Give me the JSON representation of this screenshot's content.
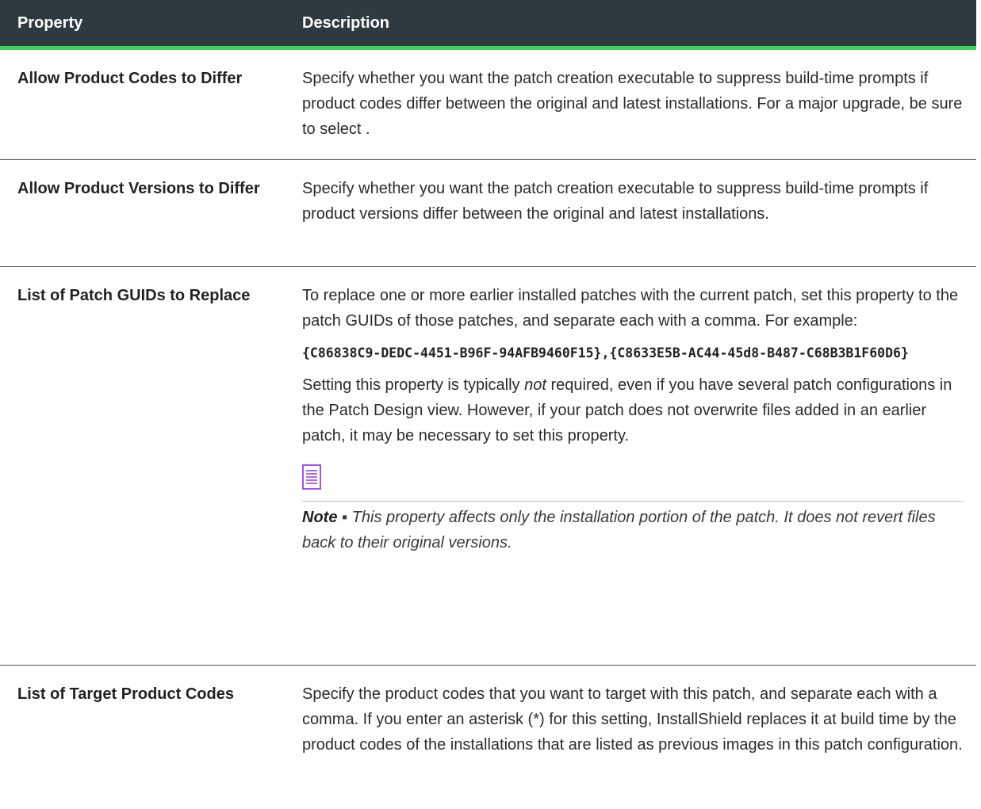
{
  "header": {
    "property": "Property",
    "description": "Description"
  },
  "rows": [
    {
      "property": "Allow Product Codes to Differ",
      "description": "Specify whether you want the patch creation executable to suppress build-time prompts if product codes differ between the original and latest installations. For a major upgrade, be sure to select ."
    },
    {
      "property": "Allow Product Versions to Differ",
      "description": "Specify whether you want the patch creation executable to suppress build-time prompts if product versions differ between the original and latest installations."
    },
    {
      "property": "List of Patch GUIDs to Replace",
      "description_p1": "To replace one or more earlier installed patches with the current patch, set this property to the patch GUIDs of those patches, and separate each with a comma. For example:",
      "code": "{C86838C9-DEDC-4451-B96F-94AFB9460F15},{C8633E5B-AC44-45d8-B487-C68B3B1F60D6}",
      "description_p2_before": "Setting this property is typically ",
      "description_p2_em": "not",
      "description_p2_after": " required, even if you have several patch configurations in the Patch Design view. However, if your patch does not overwrite files added in an earlier patch, it may be necessary to set this property.",
      "note_label": "Note",
      "note_sep": " ▪ ",
      "note_text": "This property affects only the installation portion of the patch. It does not revert files back to their original versions.",
      "note_icon": "note-icon"
    },
    {
      "property": "List of Target Product Codes",
      "description": "Specify the product codes that you want to target with this patch, and separate each with a comma. If you enter an asterisk (*) for this setting, InstallShield replaces it at build time by the product codes of the installations that are listed as previous images in this patch configuration."
    }
  ],
  "colors": {
    "header_bg": "#2f3a40",
    "header_accent": "#3bd45e",
    "note_icon": "#8a2be2"
  }
}
